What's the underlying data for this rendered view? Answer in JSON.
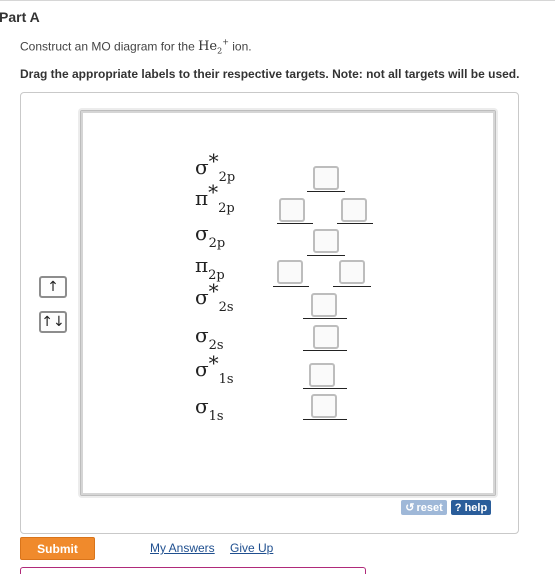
{
  "part_title": "Part A",
  "instruction": {
    "before": "Construct an MO diagram for the ",
    "formula_base": "He",
    "formula_sub": "2",
    "formula_sup": "+",
    "after": " ion."
  },
  "drag_note": "Drag the appropriate labels to their respective targets. Note: not all targets will be used.",
  "label_tiles": [
    {
      "symbol": "↑"
    },
    {
      "symbol": "↑↓"
    }
  ],
  "orbitals": [
    {
      "base": "σ",
      "star": "*",
      "sub": "2p"
    },
    {
      "base": "π",
      "star": "*",
      "sub": "2p"
    },
    {
      "base": "σ",
      "star": "",
      "sub": "2p"
    },
    {
      "base": "π",
      "star": "",
      "sub": "2p"
    },
    {
      "base": "σ",
      "star": "*",
      "sub": "2s"
    },
    {
      "base": "σ",
      "star": "",
      "sub": "2s"
    },
    {
      "base": "σ",
      "star": "*",
      "sub": "1s"
    },
    {
      "base": "σ",
      "star": "",
      "sub": "1s"
    }
  ],
  "buttons": {
    "reset": "reset",
    "help": "? help",
    "submit": "Submit"
  },
  "links": {
    "my_answers": "My Answers",
    "give_up": "Give Up"
  },
  "colors": {
    "submit": "#f08a2c",
    "help": "#2a5d9a",
    "reset": "#9fb8d8",
    "link": "#1f4f8f"
  }
}
